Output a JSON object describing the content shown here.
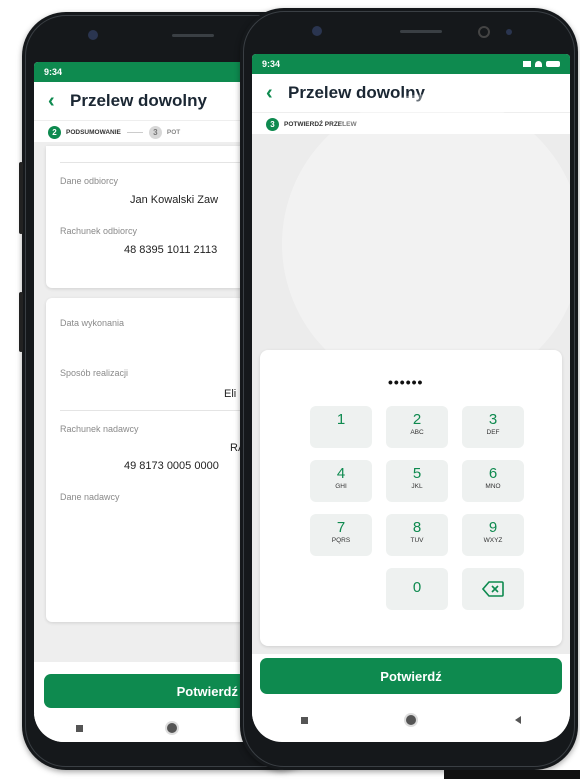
{
  "back_phone": {
    "status_time": "9:34",
    "title": "Przelew dowolny",
    "steps": [
      {
        "num": "2",
        "label": "PODSUMOWANIE"
      },
      {
        "num": "3",
        "label": "POT"
      }
    ],
    "recipient_label": "Dane odbiorcy",
    "recipient_value": "Jan Kowalski Zaw",
    "recipient_account_label": "Rachunek odbiorcy",
    "recipient_account_value": "48 8395 1011 2113",
    "date_label": "Data wykonania",
    "method_label": "Sposób realizacji",
    "method_value": "Eli",
    "sender_account_label": "Rachunek nadawcy",
    "sender_account_name": "RAC",
    "sender_account_value": "49 8173 0005 0000",
    "sender_label": "Dane nadawcy",
    "confirm_label": "Potwierdź"
  },
  "front_phone": {
    "status_time": "9:34",
    "title": "Przelew dowolny",
    "step": {
      "num": "3",
      "label": "POTWIERDŹ PRZELEW"
    },
    "pin_mask": "••••••",
    "keys": [
      {
        "digit": "1",
        "letters": ""
      },
      {
        "digit": "2",
        "letters": "ABC"
      },
      {
        "digit": "3",
        "letters": "DEF"
      },
      {
        "digit": "4",
        "letters": "GHI"
      },
      {
        "digit": "5",
        "letters": "JKL"
      },
      {
        "digit": "6",
        "letters": "MNO"
      },
      {
        "digit": "7",
        "letters": "PQRS"
      },
      {
        "digit": "8",
        "letters": "TUV"
      },
      {
        "digit": "9",
        "letters": "WXYZ"
      },
      {
        "digit": "0",
        "letters": ""
      }
    ],
    "confirm_label": "Potwierdź"
  },
  "colors": {
    "brand_green": "#0e8a4f",
    "bezel": "#15181b"
  }
}
